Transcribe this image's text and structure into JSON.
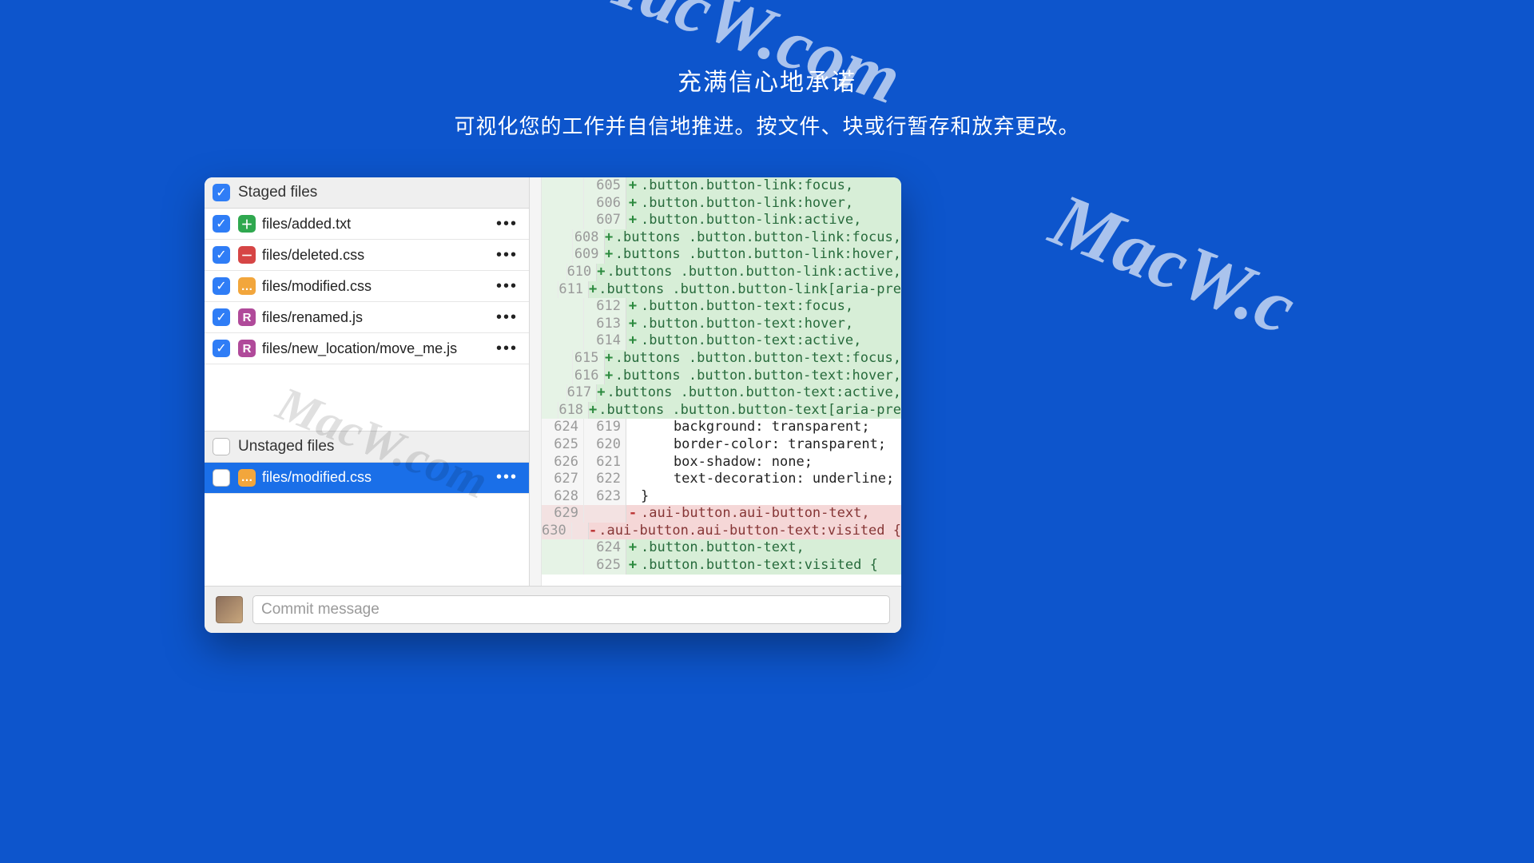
{
  "hero": {
    "title": "充满信心地承诺",
    "subtitle": "可视化您的工作并自信地推进。按文件、块或行暂存和放弃更改。"
  },
  "watermarks": {
    "w1": "MacW.com",
    "w2": "MacW.c",
    "w3": "MacW.com"
  },
  "staged_header": "Staged files",
  "unstaged_header": "Unstaged files",
  "staged_files": [
    {
      "icon": "add",
      "name": "files/added.txt"
    },
    {
      "icon": "deleted",
      "name": "files/deleted.css"
    },
    {
      "icon": "mod",
      "name": "files/modified.css"
    },
    {
      "icon": "renamed",
      "name": "files/renamed.js"
    },
    {
      "icon": "renamed",
      "name": "files/new_location/move_me.js"
    }
  ],
  "unstaged_files": [
    {
      "icon": "mod",
      "name": "files/modified.css"
    }
  ],
  "commit": {
    "placeholder": "Commit message"
  },
  "diff_lines": [
    {
      "old": "",
      "new": "605",
      "kind": "add",
      "text": ".button.button-link:focus,"
    },
    {
      "old": "",
      "new": "606",
      "kind": "add",
      "text": ".button.button-link:hover,"
    },
    {
      "old": "",
      "new": "607",
      "kind": "add",
      "text": ".button.button-link:active,"
    },
    {
      "old": "",
      "new": "608",
      "kind": "add",
      "text": ".buttons .button.button-link:focus,"
    },
    {
      "old": "",
      "new": "609",
      "kind": "add",
      "text": ".buttons .button.button-link:hover,"
    },
    {
      "old": "",
      "new": "610",
      "kind": "add",
      "text": ".buttons .button.button-link:active,"
    },
    {
      "old": "",
      "new": "611",
      "kind": "add",
      "text": ".buttons .button.button-link[aria-pre"
    },
    {
      "old": "",
      "new": "612",
      "kind": "add",
      "text": ".button.button-text:focus,"
    },
    {
      "old": "",
      "new": "613",
      "kind": "add",
      "text": ".button.button-text:hover,"
    },
    {
      "old": "",
      "new": "614",
      "kind": "add",
      "text": ".button.button-text:active,"
    },
    {
      "old": "",
      "new": "615",
      "kind": "add",
      "text": ".buttons .button.button-text:focus,"
    },
    {
      "old": "",
      "new": "616",
      "kind": "add",
      "text": ".buttons .button.button-text:hover,"
    },
    {
      "old": "",
      "new": "617",
      "kind": "add",
      "text": ".buttons .button.button-text:active,"
    },
    {
      "old": "",
      "new": "618",
      "kind": "add",
      "text": ".buttons .button.button-text[aria-pre"
    },
    {
      "old": "624",
      "new": "619",
      "kind": "ctx",
      "text": "    background: transparent;"
    },
    {
      "old": "625",
      "new": "620",
      "kind": "ctx",
      "text": "    border-color: transparent;"
    },
    {
      "old": "626",
      "new": "621",
      "kind": "ctx",
      "text": "    box-shadow: none;"
    },
    {
      "old": "627",
      "new": "622",
      "kind": "ctx",
      "text": "    text-decoration: underline;"
    },
    {
      "old": "628",
      "new": "623",
      "kind": "ctx",
      "text": "}"
    },
    {
      "old": "629",
      "new": "",
      "kind": "del",
      "text": ".aui-button.aui-button-text,"
    },
    {
      "old": "630",
      "new": "",
      "kind": "del",
      "text": ".aui-button.aui-button-text:visited {"
    },
    {
      "old": "",
      "new": "624",
      "kind": "add",
      "text": ".button.button-text,"
    },
    {
      "old": "",
      "new": "625",
      "kind": "add",
      "text": ".button.button-text:visited {"
    }
  ]
}
